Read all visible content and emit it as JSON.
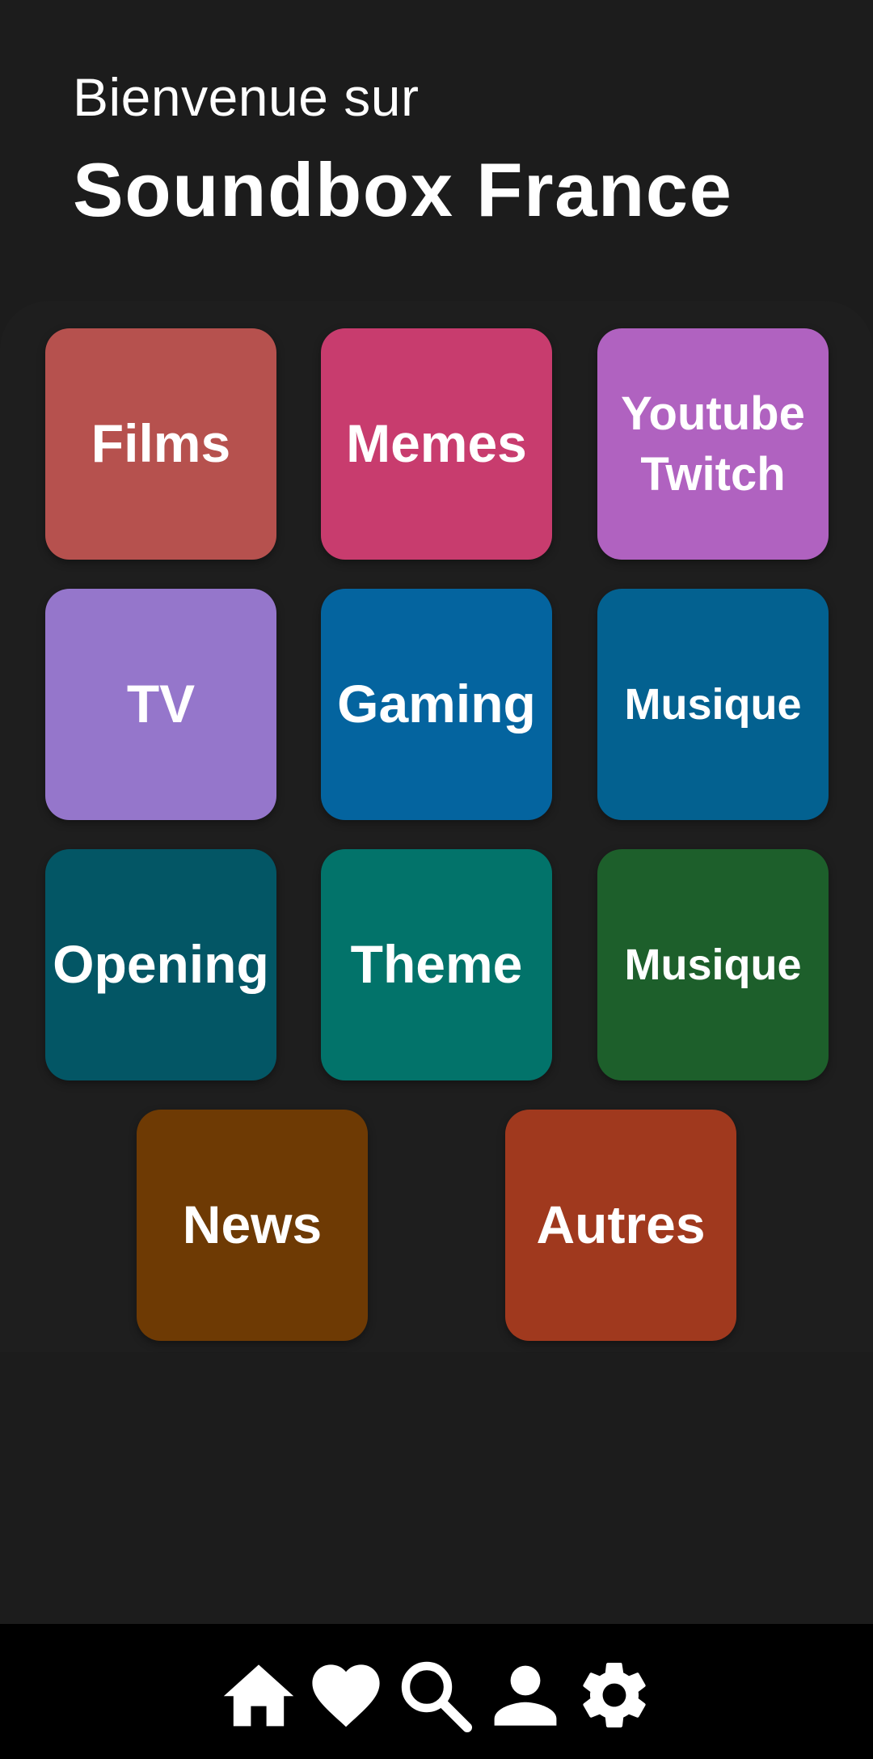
{
  "header": {
    "welcome": "Bienvenue sur",
    "title": "Soundbox France"
  },
  "categories": [
    {
      "label_line1": "Films",
      "label_line2": "",
      "color": "#b6514e"
    },
    {
      "label_line1": "Memes",
      "label_line2": "",
      "color": "#c83c6e"
    },
    {
      "label_line1": "Youtube",
      "label_line2": "Twitch",
      "color": "#b062c0"
    },
    {
      "label_line1": "TV",
      "label_line2": "",
      "color": "#9576cb"
    },
    {
      "label_line1": "Gaming",
      "label_line2": "",
      "color": "#04649f"
    },
    {
      "label_line1": "Musique",
      "label_line2": "",
      "color": "#036190"
    },
    {
      "label_line1": "Opening",
      "label_line2": "",
      "color": "#035665"
    },
    {
      "label_line1": "Theme",
      "label_line2": "",
      "color": "#02736a"
    },
    {
      "label_line1": "Musique",
      "label_line2": "",
      "color": "#1d5f2b"
    },
    {
      "label_line1": "News",
      "label_line2": "",
      "color": "#6e3a04"
    },
    {
      "label_line1": "Autres",
      "label_line2": "",
      "color": "#a0391e"
    }
  ],
  "bottom_nav": {
    "items": [
      {
        "icon": "home-icon"
      },
      {
        "icon": "heart-icon"
      },
      {
        "icon": "search-icon"
      },
      {
        "icon": "person-icon"
      },
      {
        "icon": "gear-icon"
      }
    ]
  },
  "colors": {
    "background": "#1c1c1c",
    "nav_background": "#000000",
    "text": "#ffffff"
  }
}
